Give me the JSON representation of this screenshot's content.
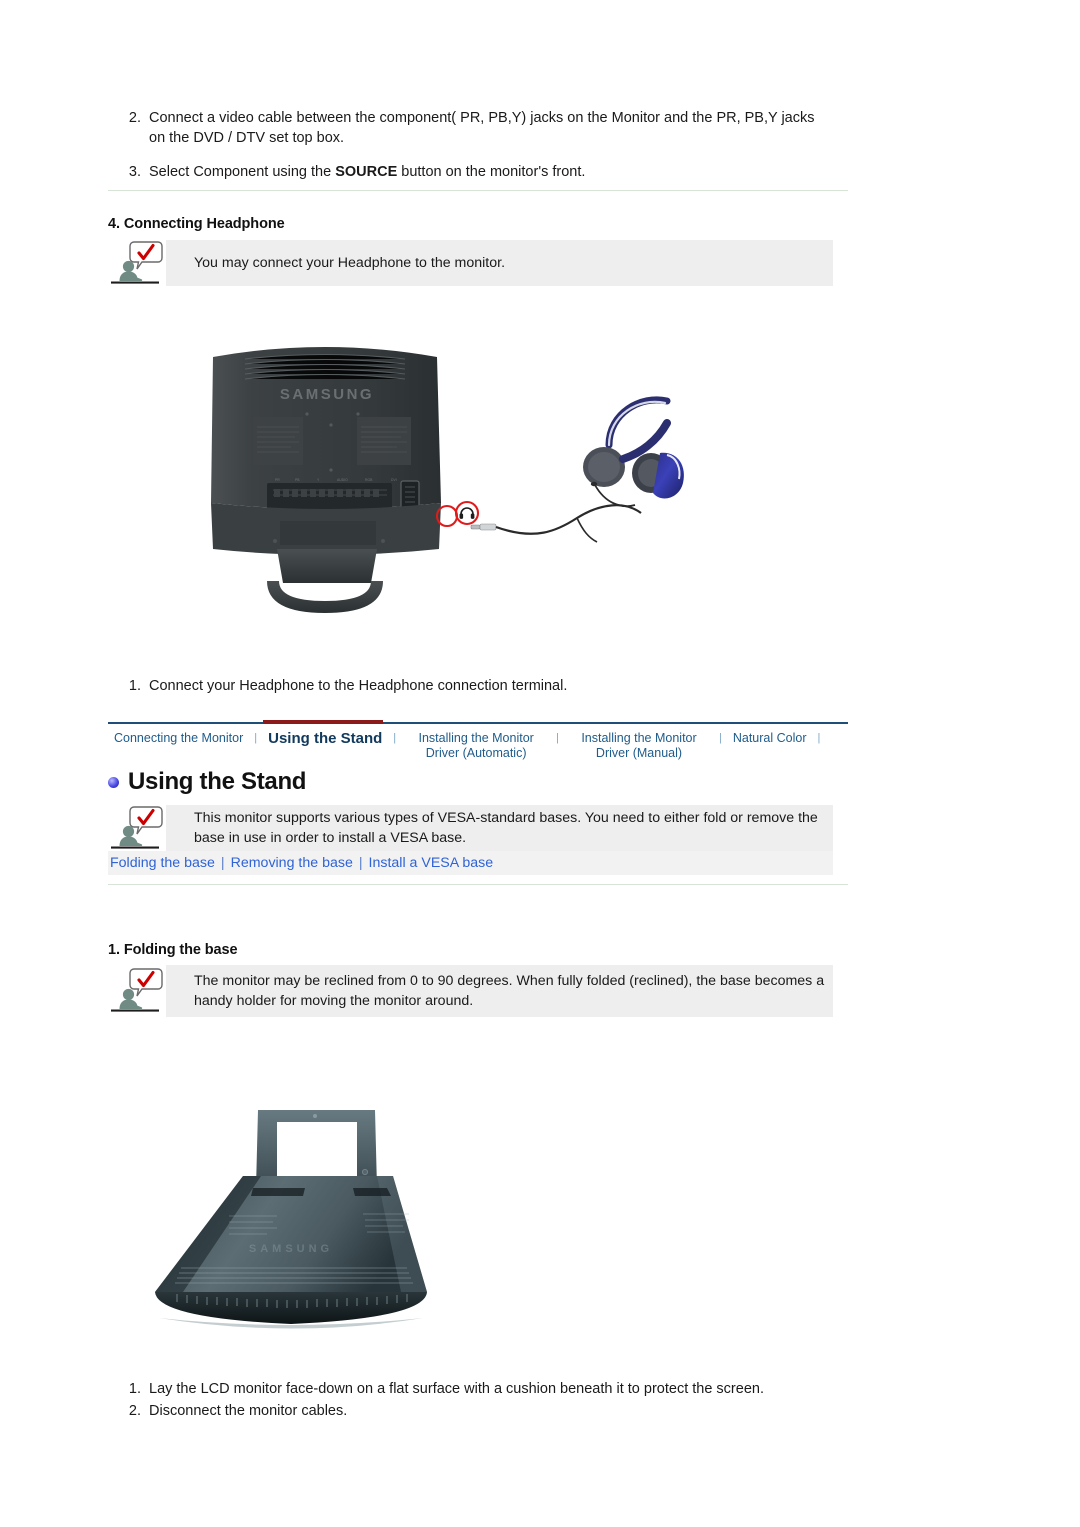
{
  "component_steps": [
    {
      "num": "2.",
      "text_pre": "Connect a video cable between the component( PR, PB,Y) jacks on the Monitor and the PR, PB,Y jacks on the DVD / DTV set top box.",
      "bold": "",
      "text_post": ""
    },
    {
      "num": "3.",
      "text_pre": "Select Component using the ",
      "bold": "SOURCE",
      "text_post": " button on the monitor's front."
    }
  ],
  "headphone_section": {
    "heading": "4. Connecting Headphone",
    "note": "You may connect your Headphone to the monitor.",
    "step_num": "1.",
    "step_text": "Connect your Headphone to the Headphone connection terminal.",
    "image_alt": "samsung-monitor-rear-with-headphone",
    "monitor_brand": "SAMSUNG"
  },
  "tabs": {
    "items": [
      {
        "label": "Connecting the Monitor",
        "active": false,
        "two_line": false
      },
      {
        "label": "Using the Stand",
        "active": true,
        "two_line": false
      },
      {
        "label": "Installing the Monitor Driver (Automatic)",
        "active": false,
        "two_line": true
      },
      {
        "label": "Installing the Monitor Driver (Manual)",
        "active": false,
        "two_line": true
      },
      {
        "label": "Natural Color",
        "active": false,
        "two_line": false
      }
    ],
    "separator": "|",
    "active_underline_color": "#8b1a1a",
    "link_color": "#1f5c8b",
    "border_color": "#1f4e79"
  },
  "stand_section": {
    "title": "Using the Stand",
    "note": "This monitor supports various types of VESA-standard bases. You need to either fold or remove the base in use in order to install a VESA base.",
    "links": [
      "Folding the base",
      "Removing the base",
      "Install a VESA base"
    ],
    "link_separator": "|"
  },
  "folding_section": {
    "heading": "1. Folding the base",
    "note": "The monitor may be reclined from 0 to 90 degrees. When fully folded (reclined), the base becomes a handy holder for moving the monitor around.",
    "image_alt": "monitor-base-folded-photo",
    "steps": [
      {
        "num": "1.",
        "text": "Lay the LCD monitor face-down on a flat surface with a cushion beneath it to protect the screen."
      },
      {
        "num": "2.",
        "text": "Disconnect the monitor cables."
      }
    ]
  },
  "icons": {
    "note_icon": "person-with-checkmark-bubble-icon",
    "title_bullet": "blue-sphere-bullet-icon",
    "headphone_marker": "headphone-jack-marker-icon"
  },
  "colors": {
    "note_bg": "#eeeeee",
    "link_bg": "#f2f2f2",
    "link_text": "#2f63d6",
    "rule": "#d9e4d9",
    "accent_red": "#8b1a1a",
    "tab_blue": "#1f5c8b"
  }
}
